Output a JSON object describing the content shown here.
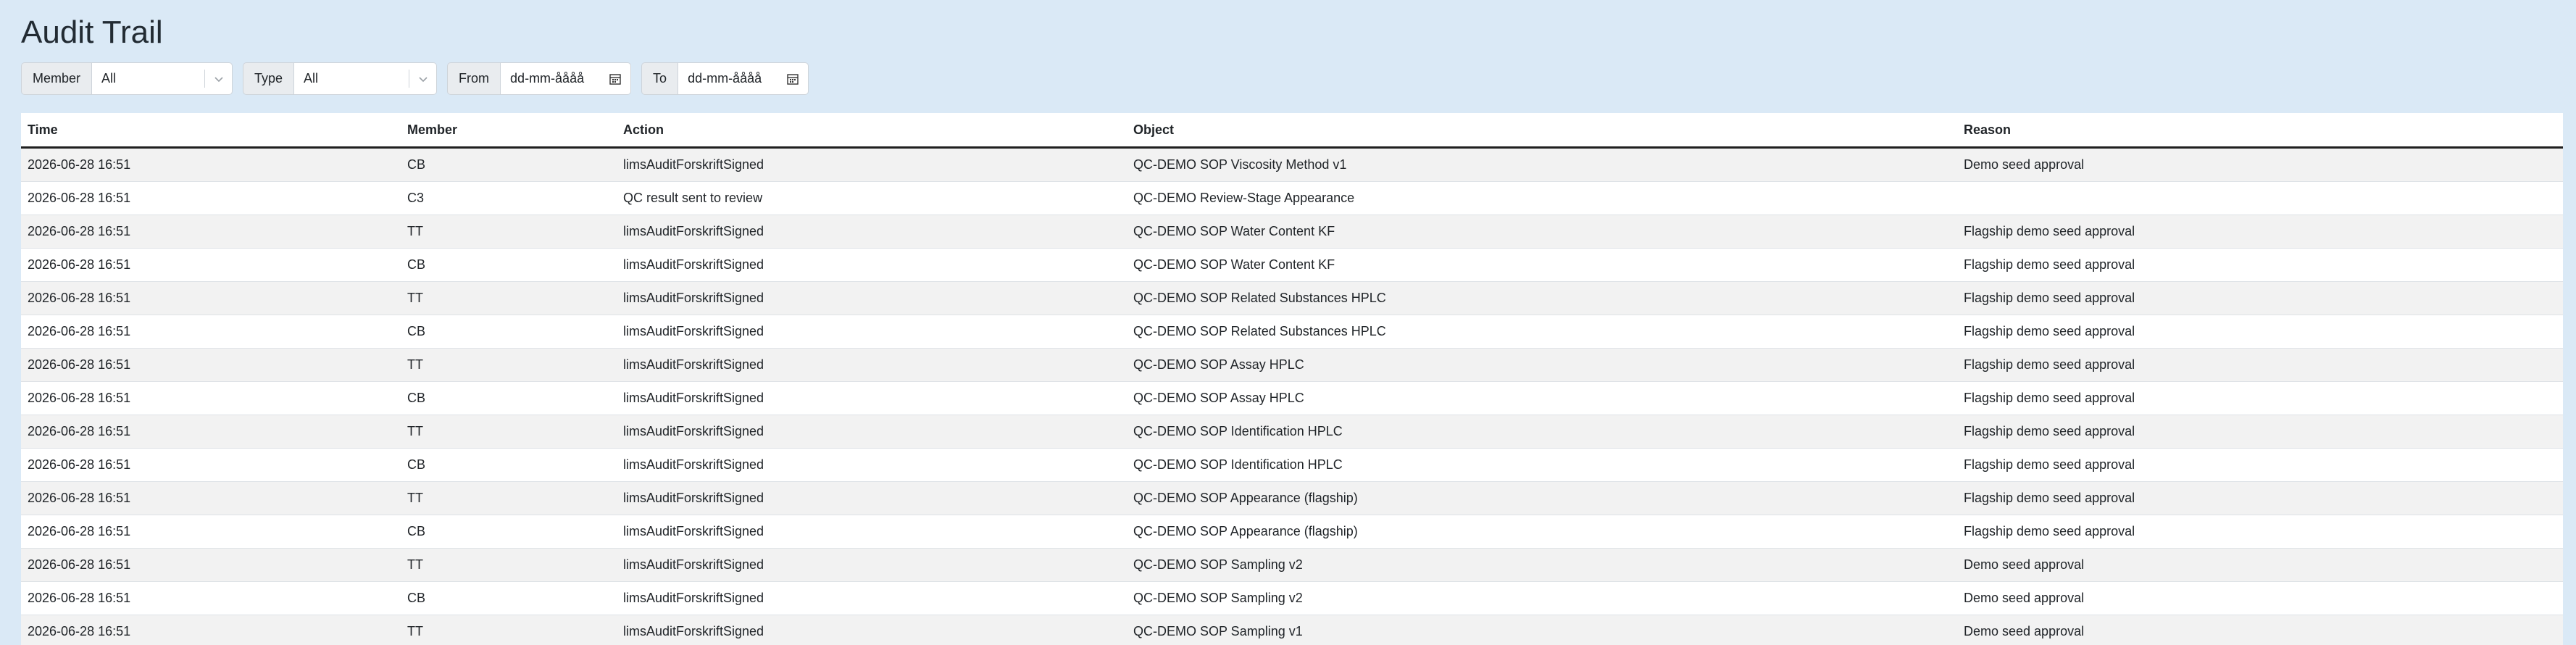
{
  "page": {
    "title": "Audit Trail"
  },
  "filters": {
    "member": {
      "label": "Member",
      "value": "All"
    },
    "type": {
      "label": "Type",
      "value": "All"
    },
    "from": {
      "label": "From",
      "value": "dd-mm-åååå"
    },
    "to": {
      "label": "To",
      "value": "dd-mm-åååå"
    }
  },
  "icons": {
    "select_chevron": "chevron-down-icon",
    "date_picker": "calendar-icon"
  },
  "table": {
    "columns": [
      "Time",
      "Member",
      "Action",
      "Object",
      "Reason"
    ],
    "rows": [
      [
        "2026-06-28 16:51",
        "CB",
        "limsAuditForskriftSigned",
        "QC-DEMO SOP Viscosity Method v1",
        "Demo seed approval"
      ],
      [
        "2026-06-28 16:51",
        "C3",
        "QC result sent to review",
        "QC-DEMO Review-Stage Appearance",
        ""
      ],
      [
        "2026-06-28 16:51",
        "TT",
        "limsAuditForskriftSigned",
        "QC-DEMO SOP Water Content KF",
        "Flagship demo seed approval"
      ],
      [
        "2026-06-28 16:51",
        "CB",
        "limsAuditForskriftSigned",
        "QC-DEMO SOP Water Content KF",
        "Flagship demo seed approval"
      ],
      [
        "2026-06-28 16:51",
        "TT",
        "limsAuditForskriftSigned",
        "QC-DEMO SOP Related Substances HPLC",
        "Flagship demo seed approval"
      ],
      [
        "2026-06-28 16:51",
        "CB",
        "limsAuditForskriftSigned",
        "QC-DEMO SOP Related Substances HPLC",
        "Flagship demo seed approval"
      ],
      [
        "2026-06-28 16:51",
        "TT",
        "limsAuditForskriftSigned",
        "QC-DEMO SOP Assay HPLC",
        "Flagship demo seed approval"
      ],
      [
        "2026-06-28 16:51",
        "CB",
        "limsAuditForskriftSigned",
        "QC-DEMO SOP Assay HPLC",
        "Flagship demo seed approval"
      ],
      [
        "2026-06-28 16:51",
        "TT",
        "limsAuditForskriftSigned",
        "QC-DEMO SOP Identification HPLC",
        "Flagship demo seed approval"
      ],
      [
        "2026-06-28 16:51",
        "CB",
        "limsAuditForskriftSigned",
        "QC-DEMO SOP Identification HPLC",
        "Flagship demo seed approval"
      ],
      [
        "2026-06-28 16:51",
        "TT",
        "limsAuditForskriftSigned",
        "QC-DEMO SOP Appearance (flagship)",
        "Flagship demo seed approval"
      ],
      [
        "2026-06-28 16:51",
        "CB",
        "limsAuditForskriftSigned",
        "QC-DEMO SOP Appearance (flagship)",
        "Flagship demo seed approval"
      ],
      [
        "2026-06-28 16:51",
        "TT",
        "limsAuditForskriftSigned",
        "QC-DEMO SOP Sampling v2",
        "Demo seed approval"
      ],
      [
        "2026-06-28 16:51",
        "CB",
        "limsAuditForskriftSigned",
        "QC-DEMO SOP Sampling v2",
        "Demo seed approval"
      ],
      [
        "2026-06-28 16:51",
        "TT",
        "limsAuditForskriftSigned",
        "QC-DEMO SOP Sampling v1",
        "Demo seed approval"
      ]
    ]
  }
}
